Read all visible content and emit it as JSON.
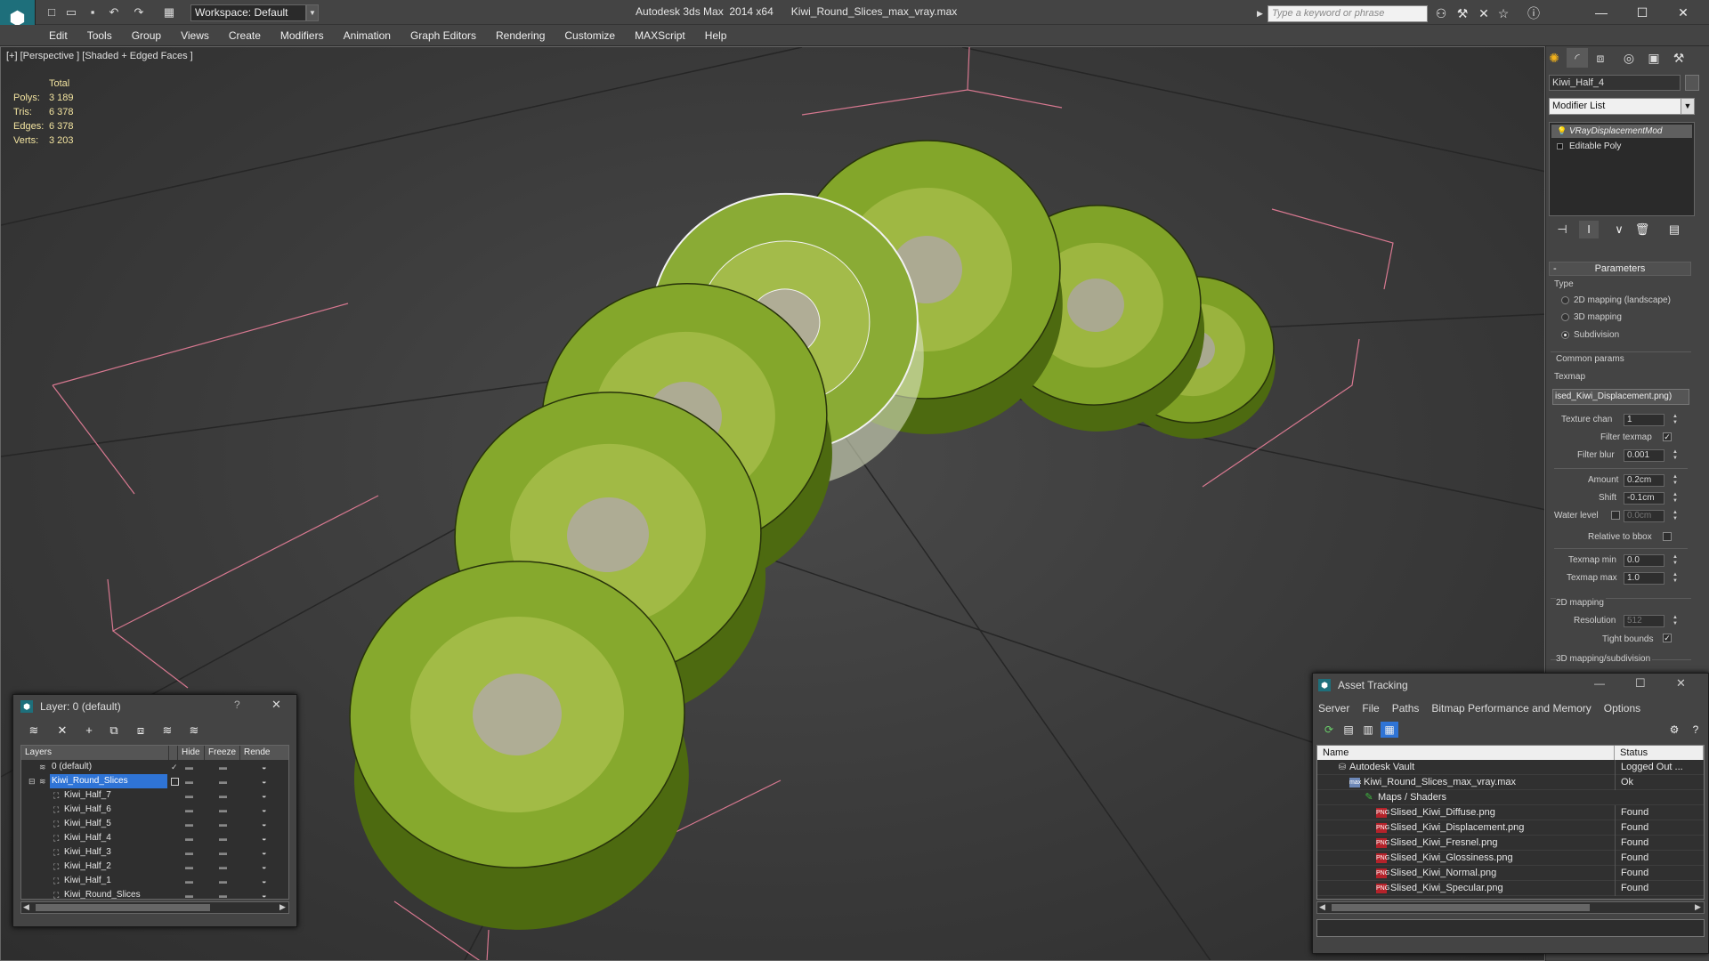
{
  "titlebar": {
    "workspace": "Workspace: Default",
    "app": "Autodesk 3ds Max  2014 x64",
    "file": "Kiwi_Round_Slices_max_vray.max",
    "search_placeholder": "Type a keyword or phrase"
  },
  "menu": [
    "Edit",
    "Tools",
    "Group",
    "Views",
    "Create",
    "Modifiers",
    "Animation",
    "Graph Editors",
    "Rendering",
    "Customize",
    "MAXScript",
    "Help"
  ],
  "viewport": {
    "label": "[+] [Perspective ] [Shaded + Edged Faces ]",
    "stats": {
      "header": "Total",
      "rows": [
        {
          "label": "Polys:",
          "value": "3 189"
        },
        {
          "label": "Tris:",
          "value": "6 378"
        },
        {
          "label": "Edges:",
          "value": "6 378"
        },
        {
          "label": "Verts:",
          "value": "3 203"
        }
      ]
    }
  },
  "command_panel": {
    "object_name": "Kiwi_Half_4",
    "modifier_list": "Modifier List",
    "stack": [
      "VRayDisplacementMod",
      "Editable Poly"
    ],
    "parameters_title": "Parameters",
    "type_label": "Type",
    "type_options": [
      "2D mapping (landscape)",
      "3D mapping",
      "Subdivision"
    ],
    "common_params": "Common params",
    "texmap_label": "Texmap",
    "texmap_value": "ised_Kiwi_Displacement.png)",
    "texture_chan_label": "Texture chan",
    "texture_chan": "1",
    "filter_texmap_label": "Filter texmap",
    "filter_blur_label": "Filter blur",
    "filter_blur": "0.001",
    "amount_label": "Amount",
    "amount": "0.2cm",
    "shift_label": "Shift",
    "shift": "-0.1cm",
    "water_level_label": "Water level",
    "water_level": "0.0cm",
    "relative_bbox_label": "Relative to bbox",
    "texmap_min_label": "Texmap min",
    "texmap_min": "0.0",
    "texmap_max_label": "Texmap max",
    "texmap_max": "1.0",
    "mapping2d_label": "2D mapping",
    "resolution_label": "Resolution",
    "resolution": "512",
    "tight_bounds_label": "Tight bounds",
    "mapping3d_label": "3D mapping/subdivision"
  },
  "layer_dialog": {
    "title": "Layer: 0 (default)",
    "question": "?",
    "columns": [
      "Layers",
      "Hide",
      "Freeze",
      "Rende"
    ],
    "rows": [
      "0 (default)",
      "Kiwi_Round_Slices",
      "Kiwi_Half_7",
      "Kiwi_Half_6",
      "Kiwi_Half_5",
      "Kiwi_Half_4",
      "Kiwi_Half_3",
      "Kiwi_Half_2",
      "Kiwi_Half_1",
      "Kiwi_Round_Slices"
    ]
  },
  "asset_dialog": {
    "title": "Asset Tracking",
    "menu": [
      "Server",
      "File",
      "Paths",
      "Bitmap Performance and Memory",
      "Options"
    ],
    "columns": [
      "Name",
      "Status"
    ],
    "rows": [
      {
        "name": "Autodesk Vault",
        "status": "Logged Out ..."
      },
      {
        "name": "Kiwi_Round_Slices_max_vray.max",
        "status": "Ok"
      },
      {
        "name": "Maps / Shaders",
        "status": ""
      },
      {
        "name": "Slised_Kiwi_Diffuse.png",
        "status": "Found"
      },
      {
        "name": "Slised_Kiwi_Displacement.png",
        "status": "Found"
      },
      {
        "name": "Slised_Kiwi_Fresnel.png",
        "status": "Found"
      },
      {
        "name": "Slised_Kiwi_Glossiness.png",
        "status": "Found"
      },
      {
        "name": "Slised_Kiwi_Normal.png",
        "status": "Found"
      },
      {
        "name": "Slised_Kiwi_Specular.png",
        "status": "Found"
      }
    ]
  }
}
